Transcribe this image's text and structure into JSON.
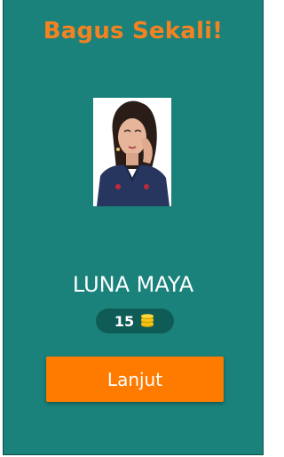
{
  "header": {
    "title": "Bagus Sekali!"
  },
  "answer": {
    "name": "LUNA MAYA",
    "photo_icon": "celebrity-portrait-image"
  },
  "coins": {
    "value": "15",
    "icon": "coin-stack-icon"
  },
  "actions": {
    "next_label": "Lanjut"
  },
  "colors": {
    "background": "#1a827b",
    "title": "#f58220",
    "button": "#ff7b00",
    "badge": "#0f5c57",
    "coin": "#f5c518"
  }
}
